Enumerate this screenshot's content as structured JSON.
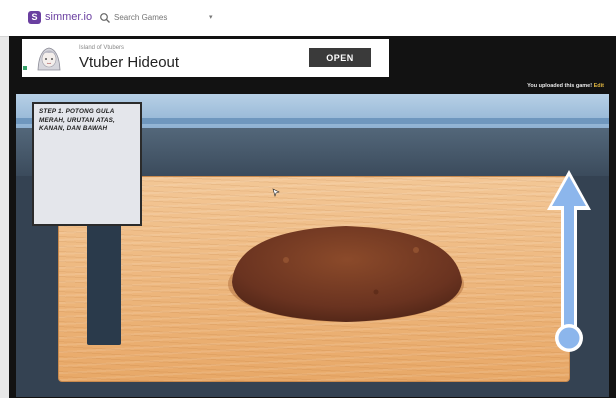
{
  "topbar": {
    "logo_letter": "S",
    "logo_text": "simmer.io",
    "search_placeholder": "Search Games",
    "search_icon": "search-icon",
    "caret": "▾"
  },
  "ad": {
    "subtitle": "Island of Vtubers",
    "title": "Vtuber Hideout",
    "open_label": "OPEN"
  },
  "upload_note": {
    "text": "You uploaded this game!",
    "edit_label": "Edit"
  },
  "game": {
    "instruction": "STEP 1.     POTONG GULA MERAH, URUTAN ATAS, KANAN, DAN BAWAH",
    "colors": {
      "board": "#e8a867",
      "cake": "#7a3c1e",
      "arrow": "#8cb6ec",
      "wall": "#3b4b5c"
    }
  }
}
